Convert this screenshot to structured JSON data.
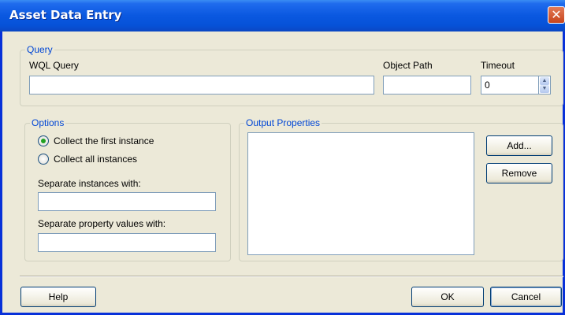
{
  "window": {
    "title": "Asset Data Entry",
    "close_glyph": "✕"
  },
  "query_group": {
    "legend": "Query",
    "wql_label": "WQL Query",
    "wql_value": "",
    "object_path_label": "Object Path",
    "object_path_value": "",
    "timeout_label": "Timeout",
    "timeout_value": "0"
  },
  "options_group": {
    "legend": "Options",
    "radio_first": "Collect the first instance",
    "radio_all": "Collect all instances",
    "selected": "first",
    "sep_instances_label": "Separate instances with:",
    "sep_instances_value": "",
    "sep_props_label": "Separate property values with:",
    "sep_props_value": ""
  },
  "output_group": {
    "legend": "Output Properties",
    "items": [],
    "add_label": "Add...",
    "remove_label": "Remove"
  },
  "footer": {
    "help_label": "Help",
    "ok_label": "OK",
    "cancel_label": "Cancel"
  },
  "colors": {
    "accent": "#0046d5",
    "titlebar": "#0a58e0",
    "face": "#ece9d8",
    "close": "#c7441b"
  },
  "icons": {
    "close": "close-icon",
    "spin_up": "spin-up-icon",
    "spin_down": "spin-down-icon"
  }
}
